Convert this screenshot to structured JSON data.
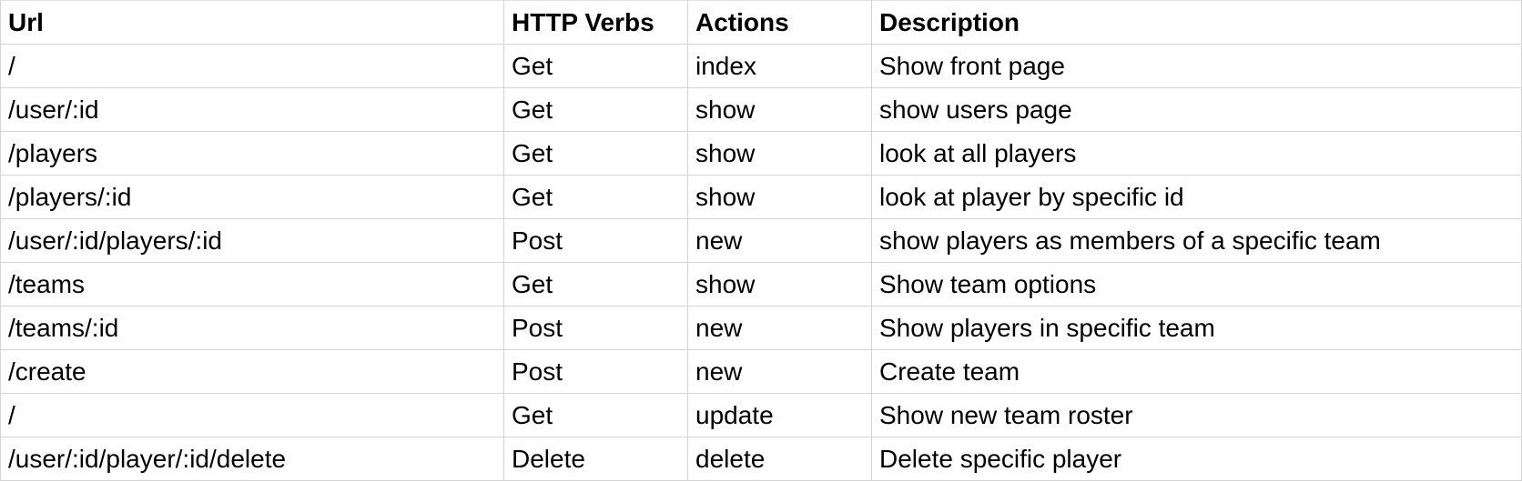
{
  "table": {
    "columns": [
      "Url",
      "HTTP Verbs",
      "Actions",
      "Description"
    ],
    "rows": [
      [
        "/",
        "Get",
        "index",
        "Show front page"
      ],
      [
        "/user/:id",
        "Get",
        "show",
        "show users page"
      ],
      [
        "/players",
        "Get",
        "show",
        "look at all players"
      ],
      [
        "/players/:id",
        "Get",
        "show",
        "look at player by specific id"
      ],
      [
        "/user/:id/players/:id",
        "Post",
        "new",
        "show players as members of a specific team"
      ],
      [
        "/teams",
        "Get",
        "show",
        "Show team options"
      ],
      [
        "/teams/:id",
        "Post",
        "new",
        "Show players in specific team"
      ],
      [
        "/create",
        "Post",
        "new",
        "Create team"
      ],
      [
        "/",
        "Get",
        "update",
        "Show new team roster"
      ],
      [
        "/user/:id/player/:id/delete",
        "Delete",
        "delete",
        "Delete specific player"
      ]
    ]
  },
  "colors": {
    "gridline": "#d4d4d4",
    "text": "#000000",
    "background": "#ffffff"
  }
}
